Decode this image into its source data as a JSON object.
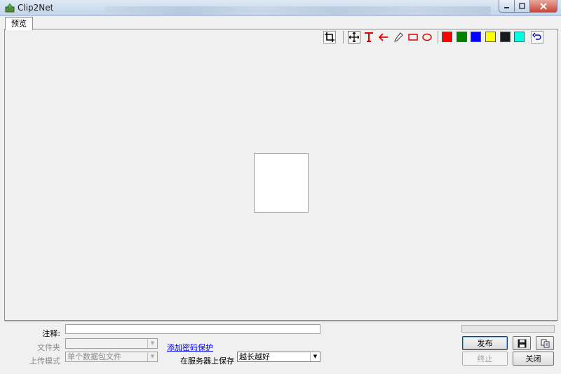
{
  "window": {
    "title": "Clip2Net"
  },
  "tabs": [
    {
      "label": "预览"
    }
  ],
  "toolbar": {
    "tools": [
      "crop-icon",
      "move-icon",
      "text-icon",
      "arrow-icon",
      "pencil-icon",
      "rectangle-icon",
      "ellipse-icon"
    ],
    "colors": [
      "#ff0000",
      "#008000",
      "#0000ff",
      "#ffff00",
      "#1a1a1a",
      "#00ffe0"
    ],
    "undo": "undo-icon"
  },
  "form": {
    "comment_label": "注释:",
    "comment_value": "",
    "folder_label": "文件夹",
    "folder_value": "",
    "upload_mode_label": "上传模式",
    "upload_mode_value": "单个数据包文件",
    "password_link": "添加密码保护",
    "save_label": "在服务器上保存",
    "save_value": "越长越好"
  },
  "buttons": {
    "publish": "发布",
    "stop": "终止",
    "close": "关闭"
  }
}
